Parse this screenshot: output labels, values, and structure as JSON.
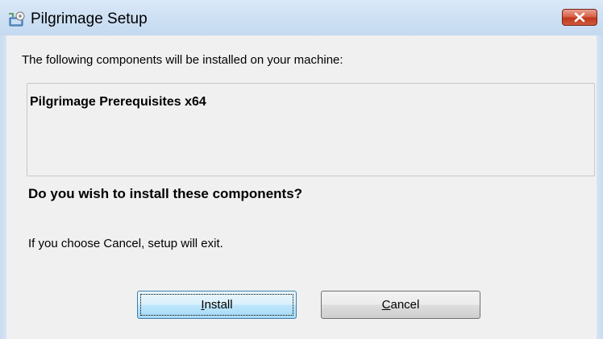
{
  "window": {
    "title": "Pilgrimage Setup",
    "app_icon": "setup-installer-icon",
    "close_icon": "close-icon"
  },
  "content": {
    "intro_text": "The following components will be installed on your machine:",
    "components": [
      "Pilgrimage Prerequisites x64"
    ],
    "question": "Do you wish to install these components?",
    "cancel_note": "If you choose Cancel, setup will exit."
  },
  "buttons": {
    "install": {
      "accel": "I",
      "rest": "nstall"
    },
    "cancel": {
      "accel": "C",
      "rest": "ancel"
    }
  },
  "colors": {
    "title_bar": "#c4d9f0",
    "close_button": "#c0381c",
    "dialog_background": "#f0f0f0",
    "default_button_border": "#3c7fb1"
  }
}
